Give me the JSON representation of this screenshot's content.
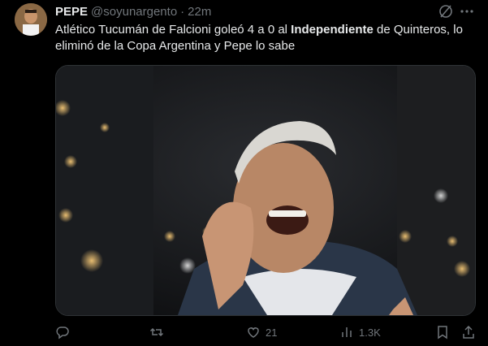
{
  "tweet": {
    "author_name": "PEPE",
    "author_handle": "@soyunargento",
    "separator": "·",
    "time": "22m",
    "text_part1": "Atlético Tucumán de Falcioni goleó 4 a 0 al ",
    "text_bold": "Independiente",
    "text_part2": " de Quinteros, lo eliminó de la Copa Argentina y Pepe lo sabe"
  },
  "actions": {
    "reply_count": "",
    "retweet_count": "",
    "like_count": "21",
    "views_count": "1.3K"
  },
  "icons": {
    "header": [
      "grok-icon",
      "more-icon"
    ],
    "actions": [
      "reply-icon",
      "retweet-icon",
      "like-icon",
      "views-icon",
      "bookmark-icon",
      "share-icon"
    ]
  },
  "colors": {
    "background": "#000000",
    "text": "#e7e9ea",
    "secondary": "#71767b",
    "border": "#2f3336"
  }
}
